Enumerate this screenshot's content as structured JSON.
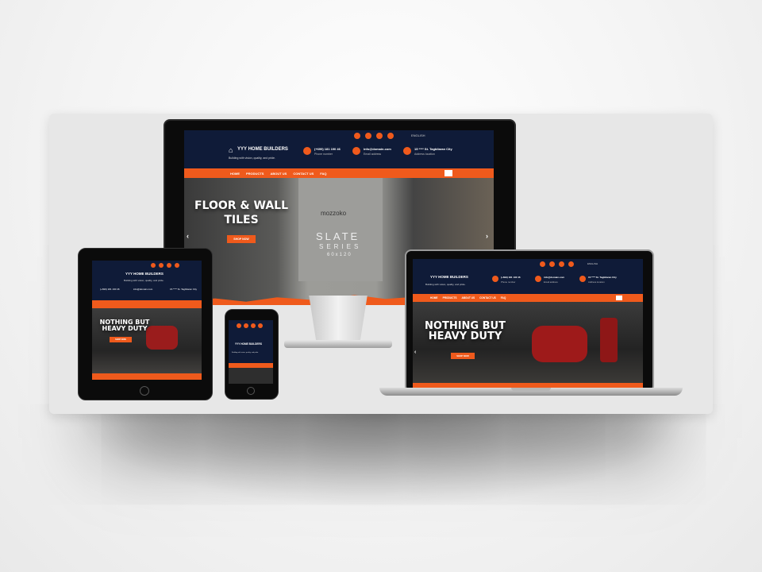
{
  "brand": {
    "name": "YYY HOME BUILDERS",
    "tagline": "Building with vision, quality, and pride."
  },
  "contact": {
    "phone": "(+699) 181 190 46",
    "phone_label": "Phone number",
    "email": "info@domain.com",
    "email_label": "Email address",
    "address": "15 **** St. Tagbilaran City",
    "address_label": "Address location"
  },
  "nav": {
    "home": "HOME",
    "products": "PRODUCTS",
    "about": "ABOUT US",
    "contact": "CONTACT US",
    "faq": "FAQ"
  },
  "topbar": {
    "lang": "ENGLISH"
  },
  "monitor": {
    "hero_line1": "FLOOR & WALL",
    "hero_line2": "TILES",
    "brand_logo": "mozzoko",
    "product_line1": "SLATE",
    "product_line2": "SERIES",
    "product_size": "60x120",
    "cta": "SHOP NOW"
  },
  "laptop": {
    "hero_line1": "NOTHING BUT",
    "hero_line2": "HEAVY DUTY",
    "cta": "SHOP NOW"
  },
  "tablet": {
    "hero_line1": "NOTHING BUT",
    "hero_line2": "HEAVY DUTY",
    "cta": "SHOP NOW"
  },
  "phone": {
    "brand": "YYY HOME BUILDERS",
    "tagline": "Building with vision, quality, and pride."
  },
  "colors": {
    "accent": "#ef5a1c",
    "navy": "#0f1b38"
  }
}
